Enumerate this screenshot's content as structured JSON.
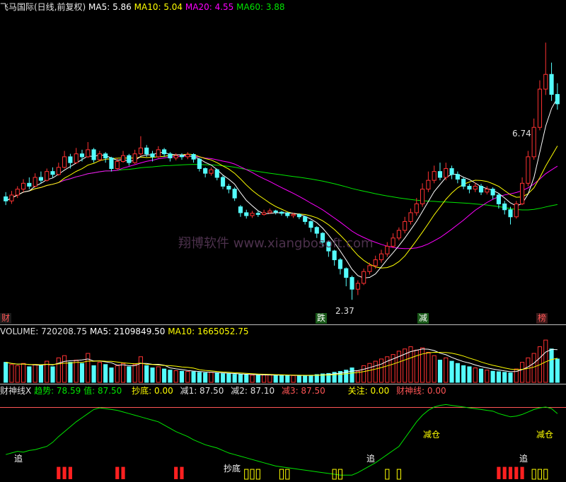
{
  "header": {
    "title": "飞马国际(日线,前复权)",
    "ma5": "MA5: 5.86",
    "ma10": "MA10: 5.04",
    "ma20": "MA20: 4.55",
    "ma60": "MA60: 3.88"
  },
  "price_annotations": {
    "high": "6.74",
    "low": "2.37"
  },
  "watermark": "翔博软件 www.xiangbosoft.com",
  "signal_tags": {
    "fall": "跌",
    "reduce": "减",
    "list": "榜",
    "edge": "财"
  },
  "volume_header": {
    "label": "VOLUME: 720208.75",
    "ma5": "MA5: 2109849.50",
    "ma10": "MA10: 1665052.75"
  },
  "indicator_header": {
    "name": "财神线X",
    "trend": "趋势: 78.59",
    "value": "值: 87.50",
    "bottom": "抄底: 0.00",
    "reduce1": "减1: 87.50",
    "reduce2": "减2: 87.10",
    "reduce3": "减3: 87.50",
    "focus": "关注: 0.00",
    "line": "财神线: 0.00"
  },
  "indicator_tags": {
    "chase1": "追",
    "bottom": "抄底",
    "chase2": "追",
    "chase3": "追",
    "reduce_pos": "减仓",
    "reduce_pos2": "减仓"
  },
  "colors": {
    "up": "#ff3232",
    "down": "#54fcfc",
    "ma5": "#ffffff",
    "ma10": "#ffff00",
    "ma20": "#ff00ff",
    "ma60": "#00e600",
    "trend": "#00e600",
    "ref": "#ff5555"
  },
  "chart_data": {
    "type": "candlestick",
    "ylim": [
      2.0,
      7.2
    ],
    "candles": [
      [
        4.12,
        4.05,
        4.2,
        3.98
      ],
      [
        4.05,
        4.15,
        4.22,
        4.0
      ],
      [
        4.15,
        4.25,
        4.3,
        4.1
      ],
      [
        4.25,
        4.35,
        4.42,
        4.2
      ],
      [
        4.35,
        4.3,
        4.45,
        4.25
      ],
      [
        4.3,
        4.45,
        4.52,
        4.28
      ],
      [
        4.45,
        4.4,
        4.55,
        4.35
      ],
      [
        4.4,
        4.55,
        4.6,
        4.38
      ],
      [
        4.55,
        4.5,
        4.62,
        4.45
      ],
      [
        4.5,
        4.62,
        4.7,
        4.48
      ],
      [
        4.62,
        4.8,
        4.9,
        4.6
      ],
      [
        4.8,
        4.7,
        4.85,
        4.6
      ],
      [
        4.7,
        4.85,
        4.95,
        4.68
      ],
      [
        4.85,
        4.8,
        4.92,
        4.72
      ],
      [
        4.8,
        4.92,
        5.05,
        4.78
      ],
      [
        4.92,
        4.75,
        4.95,
        4.7
      ],
      [
        4.75,
        4.85,
        4.9,
        4.72
      ],
      [
        4.85,
        4.78,
        4.88,
        4.7
      ],
      [
        4.78,
        4.6,
        4.8,
        4.55
      ],
      [
        4.6,
        4.72,
        4.78,
        4.58
      ],
      [
        4.72,
        4.82,
        4.9,
        4.7
      ],
      [
        4.82,
        4.7,
        4.85,
        4.65
      ],
      [
        4.7,
        4.85,
        4.92,
        4.68
      ],
      [
        4.85,
        4.95,
        5.15,
        4.82
      ],
      [
        4.95,
        4.85,
        5.0,
        4.8
      ],
      [
        4.85,
        4.8,
        4.9,
        4.72
      ],
      [
        4.8,
        4.92,
        4.98,
        4.78
      ],
      [
        4.92,
        4.85,
        4.95,
        4.8
      ],
      [
        4.85,
        4.78,
        4.88,
        4.72
      ],
      [
        4.78,
        4.82,
        4.86,
        4.74
      ],
      [
        4.82,
        4.8,
        4.86,
        4.75
      ],
      [
        4.8,
        4.84,
        4.88,
        4.76
      ],
      [
        4.84,
        4.76,
        4.86,
        4.7
      ],
      [
        4.76,
        4.6,
        4.78,
        4.55
      ],
      [
        4.6,
        4.52,
        4.62,
        4.45
      ],
      [
        4.52,
        4.58,
        4.62,
        4.48
      ],
      [
        4.58,
        4.45,
        4.6,
        4.4
      ],
      [
        4.45,
        4.3,
        4.48,
        4.25
      ],
      [
        4.3,
        4.25,
        4.34,
        4.18
      ],
      [
        4.25,
        4.1,
        4.28,
        4.05
      ],
      [
        3.95,
        3.85,
        3.98,
        3.78
      ],
      [
        3.85,
        3.8,
        3.9,
        3.75
      ],
      [
        3.8,
        3.84,
        3.88,
        3.76
      ],
      [
        3.84,
        3.82,
        3.88,
        3.78
      ],
      [
        3.82,
        3.85,
        3.9,
        3.8
      ],
      [
        3.85,
        3.88,
        3.92,
        3.83
      ],
      [
        3.88,
        3.86,
        3.9,
        3.82
      ],
      [
        3.86,
        3.84,
        3.88,
        3.8
      ],
      [
        3.84,
        3.8,
        3.86,
        3.76
      ],
      [
        3.8,
        3.82,
        3.85,
        3.76
      ],
      [
        3.82,
        3.78,
        3.84,
        3.74
      ],
      [
        3.78,
        3.7,
        3.8,
        3.65
      ],
      [
        3.7,
        3.6,
        3.72,
        3.52
      ],
      [
        3.6,
        3.5,
        3.62,
        3.42
      ],
      [
        3.5,
        3.35,
        3.52,
        3.28
      ],
      [
        3.35,
        3.2,
        3.38,
        3.1
      ],
      [
        3.2,
        3.05,
        3.22,
        2.95
      ],
      [
        3.05,
        2.9,
        3.08,
        2.8
      ],
      [
        2.9,
        2.75,
        2.92,
        2.6
      ],
      [
        2.75,
        2.55,
        2.78,
        2.37
      ],
      [
        2.55,
        2.65,
        2.7,
        2.45
      ],
      [
        2.65,
        2.85,
        2.9,
        2.62
      ],
      [
        2.85,
        2.95,
        3.0,
        2.8
      ],
      [
        2.95,
        3.05,
        3.12,
        2.9
      ],
      [
        3.05,
        3.15,
        3.22,
        3.0
      ],
      [
        3.15,
        3.28,
        3.35,
        3.1
      ],
      [
        3.28,
        3.42,
        3.5,
        3.25
      ],
      [
        3.42,
        3.55,
        3.6,
        3.38
      ],
      [
        3.55,
        3.7,
        3.78,
        3.5
      ],
      [
        3.7,
        3.85,
        3.92,
        3.65
      ],
      [
        3.85,
        4.0,
        4.1,
        3.8
      ],
      [
        4.0,
        4.25,
        4.35,
        3.95
      ],
      [
        4.25,
        4.4,
        4.55,
        4.2
      ],
      [
        4.4,
        4.55,
        4.65,
        4.35
      ],
      [
        4.55,
        4.45,
        4.7,
        4.4
      ],
      [
        4.45,
        4.6,
        4.7,
        4.4
      ],
      [
        4.6,
        4.5,
        4.65,
        4.42
      ],
      [
        4.5,
        4.42,
        4.55,
        4.35
      ],
      [
        4.42,
        4.3,
        4.45,
        4.25
      ],
      [
        4.3,
        4.25,
        4.34,
        4.18
      ],
      [
        4.25,
        4.3,
        4.36,
        4.2
      ],
      [
        4.3,
        4.2,
        4.34,
        4.15
      ],
      [
        4.2,
        4.25,
        4.3,
        4.16
      ],
      [
        4.25,
        4.15,
        4.28,
        4.08
      ],
      [
        4.15,
        4.0,
        4.18,
        3.92
      ],
      [
        4.0,
        3.9,
        4.05,
        3.82
      ],
      [
        3.9,
        3.78,
        3.95,
        3.65
      ],
      [
        3.78,
        4.0,
        4.05,
        3.75
      ],
      [
        4.0,
        4.35,
        4.45,
        3.98
      ],
      [
        4.35,
        4.8,
        4.9,
        4.3
      ],
      [
        4.8,
        5.3,
        5.45,
        4.75
      ],
      [
        5.3,
        5.95,
        6.1,
        5.25
      ],
      [
        5.95,
        6.2,
        6.74,
        5.85
      ],
      [
        6.2,
        5.86,
        6.4,
        5.75
      ],
      [
        5.86,
        5.7,
        6.05,
        5.6
      ]
    ],
    "volume_ylim": [
      0,
      4000000
    ],
    "volume": [
      1800000,
      1600000,
      1500000,
      1700000,
      1400000,
      1600000,
      1500000,
      1900000,
      1400000,
      2200000,
      2400000,
      1800000,
      2000000,
      1700000,
      2600000,
      1500000,
      1800000,
      1600000,
      1300000,
      1500000,
      1700000,
      1400000,
      1600000,
      2300000,
      1500000,
      1300000,
      1400000,
      1200000,
      1100000,
      1050000,
      1000000,
      980000,
      950000,
      900000,
      850000,
      900000,
      820000,
      780000,
      760000,
      720000,
      700000,
      680000,
      650000,
      640000,
      660000,
      670000,
      650000,
      640000,
      620000,
      610000,
      600000,
      620000,
      640000,
      700000,
      760000,
      800000,
      900000,
      980000,
      1100000,
      1300000,
      1000000,
      1500000,
      1700000,
      1900000,
      2100000,
      2300000,
      2500000,
      2800000,
      3000000,
      3200000,
      2900000,
      3100000,
      2700000,
      2400000,
      2000000,
      2200000,
      1900000,
      1700000,
      1500000,
      1400000,
      1300000,
      1200000,
      1100000,
      1000000,
      950000,
      900000,
      850000,
      1200000,
      1800000,
      2200000,
      2600000,
      3200000,
      3800000,
      3000000,
      2100000
    ],
    "indicator_ylim": [
      0,
      100
    ],
    "indicator_ref": 87.5,
    "trend": [
      30,
      32,
      34,
      33,
      35,
      36,
      38,
      40,
      45,
      52,
      58,
      64,
      70,
      75,
      80,
      85,
      87,
      86,
      85,
      84,
      82,
      80,
      78,
      76,
      74,
      72,
      70,
      66,
      62,
      58,
      55,
      52,
      48,
      45,
      42,
      40,
      38,
      35,
      32,
      30,
      28,
      26,
      24,
      22,
      20,
      18,
      16,
      15,
      14,
      13,
      12,
      11,
      10,
      9,
      8,
      7,
      6,
      5,
      5,
      5,
      8,
      12,
      16,
      20,
      25,
      30,
      35,
      40,
      50,
      60,
      70,
      78,
      84,
      88,
      90,
      91,
      90,
      89,
      88,
      87,
      86,
      85,
      84,
      83,
      80,
      78,
      76,
      77,
      79,
      82,
      85,
      87,
      88,
      86,
      80
    ],
    "bars": {
      "red": [
        9,
        10,
        11,
        19,
        20,
        29,
        30,
        84,
        85,
        86,
        87,
        88
      ],
      "yellow": [
        41,
        42,
        43,
        47,
        48,
        56,
        57,
        65,
        67,
        90,
        91,
        92
      ]
    }
  }
}
